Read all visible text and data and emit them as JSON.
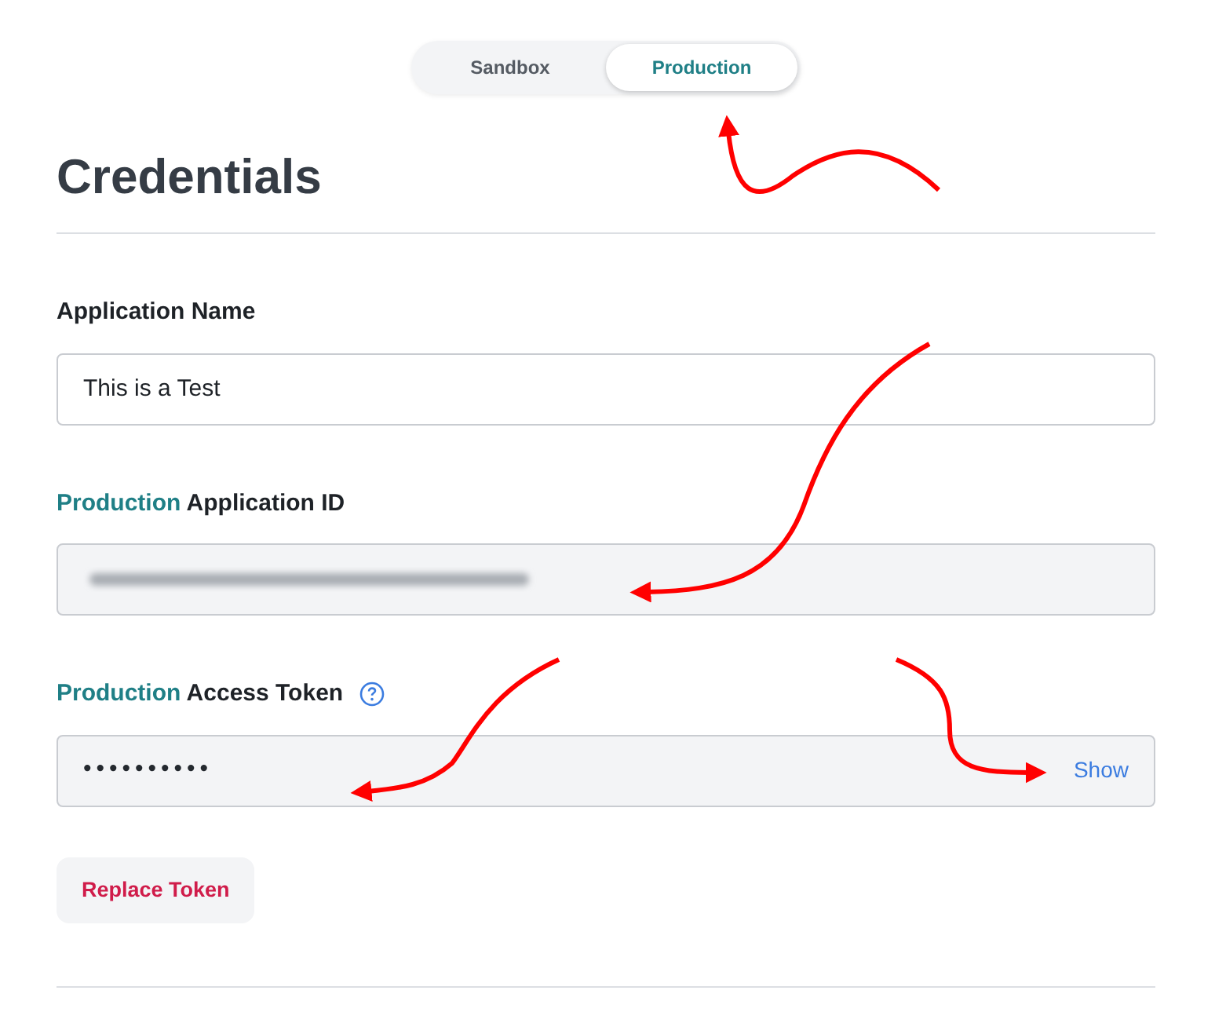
{
  "environment_toggle": [
    {
      "label": "Sandbox",
      "selected": false
    },
    {
      "label": "Production",
      "selected": true
    }
  ],
  "title": "Credentials",
  "fields": [
    {
      "kind": "text",
      "label": {
        "text": "Application Name"
      },
      "value": "This is a Test"
    },
    {
      "kind": "redacted",
      "label": {
        "prefix": "Production",
        "text": "Application ID"
      }
    },
    {
      "kind": "secret",
      "label": {
        "prefix": "Production",
        "text": "Access Token"
      },
      "help": true,
      "value": "••••••••••",
      "action": "Show"
    }
  ],
  "replace_button": "Replace Token"
}
